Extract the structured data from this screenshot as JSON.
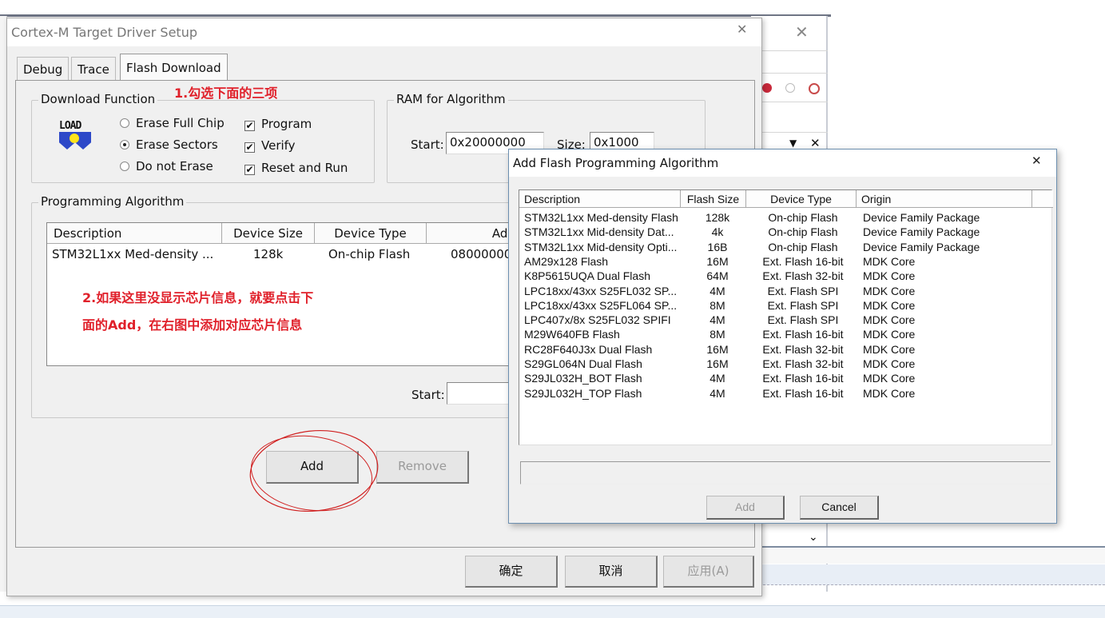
{
  "main_dialog": {
    "title": "Cortex-M Target Driver Setup",
    "tabs": [
      {
        "label": "Debug"
      },
      {
        "label": "Trace"
      },
      {
        "label": "Flash Download",
        "active": true
      }
    ],
    "download_function": {
      "label": "Download Function",
      "icon": "load-icon",
      "erase_options": [
        {
          "label": "Erase Full Chip",
          "selected": false
        },
        {
          "label": "Erase Sectors",
          "selected": true
        },
        {
          "label": "Do not Erase",
          "selected": false
        }
      ],
      "checks": [
        {
          "label": "Program",
          "checked": true
        },
        {
          "label": "Verify",
          "checked": true
        },
        {
          "label": "Reset and Run",
          "checked": true
        }
      ]
    },
    "ram": {
      "label": "RAM for Algorithm",
      "start_label": "Start:",
      "start_value": "0x20000000",
      "size_label": "Size:",
      "size_value": "0x1000"
    },
    "programming_algorithm": {
      "label": "Programming Algorithm",
      "columns": [
        "Description",
        "Device Size",
        "Device Type",
        "Addr"
      ],
      "rows": [
        [
          "STM32L1xx Med-density ...",
          "128k",
          "On-chip Flash",
          "08000000"
        ]
      ],
      "start_label": "Start:",
      "add_label": "Add",
      "remove_label": "Remove"
    },
    "buttons": {
      "ok": "确定",
      "cancel": "取消",
      "apply": "应用(A)"
    }
  },
  "annotations": {
    "note1": "1.勾选下面的三项",
    "note2_line1": "2.如果这里没显示芯片信息，就要点击下",
    "note2_line2": "面的Add，在右图中添加对应芯片信息",
    "circle_color": "#d02020"
  },
  "add_dialog": {
    "title": "Add Flash Programming Algorithm",
    "columns": [
      "Description",
      "Flash Size",
      "Device Type",
      "Origin"
    ],
    "rows": [
      [
        "STM32L1xx Med-density Flash",
        "128k",
        "On-chip Flash",
        "Device Family Package"
      ],
      [
        "STM32L1xx Mid-density Dat...",
        "4k",
        "On-chip Flash",
        "Device Family Package"
      ],
      [
        "STM32L1xx Mid-density Opti...",
        "16B",
        "On-chip Flash",
        "Device Family Package"
      ],
      [
        "AM29x128 Flash",
        "16M",
        "Ext. Flash 16-bit",
        "MDK Core"
      ],
      [
        "K8P5615UQA Dual Flash",
        "64M",
        "Ext. Flash 32-bit",
        "MDK Core"
      ],
      [
        "LPC18xx/43xx S25FL032 SP...",
        "4M",
        "Ext. Flash SPI",
        "MDK Core"
      ],
      [
        "LPC18xx/43xx S25FL064 SP...",
        "8M",
        "Ext. Flash SPI",
        "MDK Core"
      ],
      [
        "LPC407x/8x S25FL032 SPIFI",
        "4M",
        "Ext. Flash SPI",
        "MDK Core"
      ],
      [
        "M29W640FB Flash",
        "8M",
        "Ext. Flash 16-bit",
        "MDK Core"
      ],
      [
        "RC28F640J3x Dual Flash",
        "16M",
        "Ext. Flash 32-bit",
        "MDK Core"
      ],
      [
        "S29GL064N Dual Flash",
        "16M",
        "Ext. Flash 32-bit",
        "MDK Core"
      ],
      [
        "S29JL032H_BOT Flash",
        "4M",
        "Ext. Flash 16-bit",
        "MDK Core"
      ],
      [
        "S29JL032H_TOP Flash",
        "4M",
        "Ext. Flash 16-bit",
        "MDK Core"
      ]
    ],
    "path_value": "",
    "add_label": "Add",
    "cancel_label": "Cancel"
  }
}
